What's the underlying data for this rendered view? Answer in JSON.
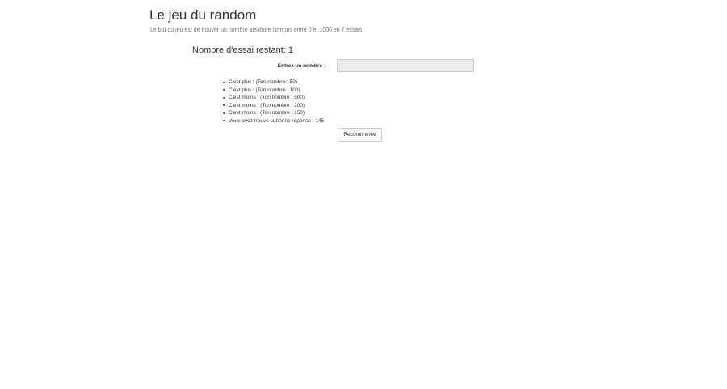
{
  "header": {
    "title": "Le jeu du random",
    "subtitle": "Le but du jeu est de trouver un nombre aléatoire compris entre 0 et 1000 en 7 essais"
  },
  "game": {
    "remaining_label": "Nombre d'essai restant: 1",
    "input_label": "Entrez un nombre :",
    "input_value": "",
    "history": [
      "C'est plus ! (Ton nombre : 50)",
      "C'est plus ! (Ton nombre : 100)",
      "C'est moins ! (Ton nombre : 500)",
      "C'est moins ! (Ton nombre : 200)",
      "C'est moins ! (Ton nombre : 150)",
      "Vous avez trouvé la bonne réponse : 145"
    ],
    "restart_label": "Recommence"
  }
}
